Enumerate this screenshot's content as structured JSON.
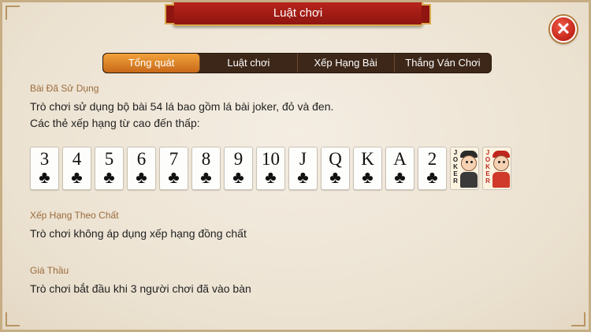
{
  "window": {
    "title": "Luật chơi",
    "close_label": "✕"
  },
  "tabs": [
    {
      "label": "Tổng quát",
      "active": true
    },
    {
      "label": "Luật chơi",
      "active": false
    },
    {
      "label": "Xếp Hạng Bài",
      "active": false
    },
    {
      "label": "Thắng Ván Chơi",
      "active": false
    }
  ],
  "sections": {
    "deck": {
      "label": "Bài Đã Sử Dụng",
      "line1": "Trò chơi sử dụng bộ bài 54 lá bao gồm lá bài joker, đỏ và đen.",
      "line2": "Các thẻ xếp hạng từ cao đến thấp:"
    },
    "suit_rank": {
      "label": "Xếp Hạng Theo Chất",
      "text": "Trò chơi không áp dụng xếp hạng đồng chất"
    },
    "bid": {
      "label": "Giá Thầu",
      "text": "Trò chơi bắt đầu khi 3 người chơi đã vào bàn"
    }
  },
  "cards": [
    "3",
    "4",
    "5",
    "6",
    "7",
    "8",
    "9",
    "10",
    "J",
    "Q",
    "K",
    "A",
    "2"
  ],
  "card_suit": "♣",
  "jokers": [
    {
      "color": "black",
      "text": "JOKER"
    },
    {
      "color": "red",
      "text": "JOKER"
    }
  ],
  "colors": {
    "accent": "#e8902c",
    "banner": "#a51d16",
    "close": "#d0281c",
    "label": "#9a6b3c"
  }
}
